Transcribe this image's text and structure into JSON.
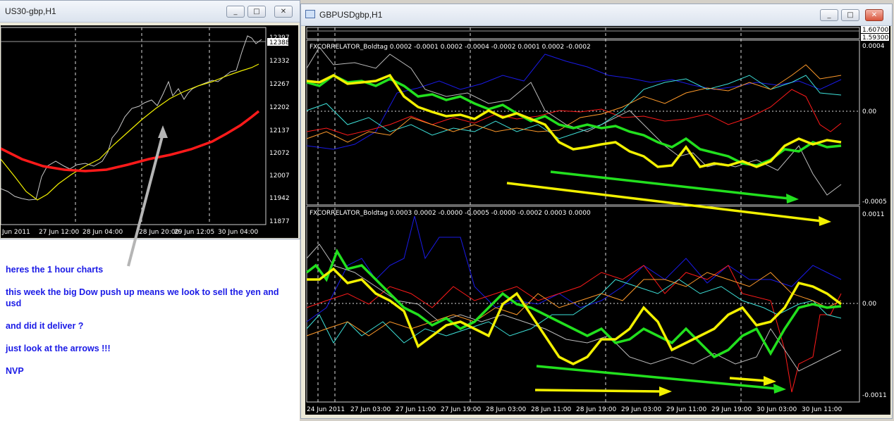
{
  "left_window": {
    "title": "US30-gbp,H1",
    "price_labels": [
      "12397",
      "12388",
      "12332",
      "12267",
      "12202",
      "12137",
      "12072",
      "12007",
      "11942",
      "11877"
    ],
    "time_labels": [
      "Jun 2011",
      "27 Jun 12:00",
      "28 Jun 04:00",
      "28 Jun 20:00",
      "29 Jun 12:05",
      "30 Jun 04:00"
    ]
  },
  "annotation": {
    "line1": "heres the 1 hour charts",
    "line2": "this week the big Dow push up means we look to sell the yen and usd",
    "line3": "and did it deliver ?",
    "line4": "just look at the arrows !!!",
    "line5": "NVP"
  },
  "right_window": {
    "title": "GBPUSDgbp,H1",
    "top_prices": [
      "1.60700",
      "1.59300"
    ],
    "panel1": {
      "header": "FXCORRELATOR_Boldtag 0.0002 -0.0001 0.0002 -0.0004 -0.0002 0.0001 0.0002 -0.0002",
      "scale": [
        "0.0004",
        "0.00",
        "-0.0005"
      ]
    },
    "panel2": {
      "header": "FXCORRELATOR_Boldtag 0.0003 0.0002 -0.0000 -0.0005 -0.0000 -0.0002 0.0003 0.0000",
      "scale": [
        "0.0011",
        "0.00",
        "-0.0011"
      ]
    },
    "time_labels": [
      "24 Jun 2011",
      "27 Jun 03:00",
      "27 Jun 11:00",
      "27 Jun 19:00",
      "28 Jun 03:00",
      "28 Jun 11:00",
      "28 Jun 19:00",
      "29 Jun 03:00",
      "29 Jun 11:00",
      "29 Jun 19:00",
      "30 Jun 03:00",
      "30 Jun 11:00"
    ]
  },
  "colors": {
    "green": "#22e01e",
    "yellow": "#f2f000",
    "red": "#ff1a1a",
    "blue": "#1a1ae6"
  },
  "window_buttons": {
    "minimize": "_",
    "maximize": "□",
    "close": "✕"
  }
}
